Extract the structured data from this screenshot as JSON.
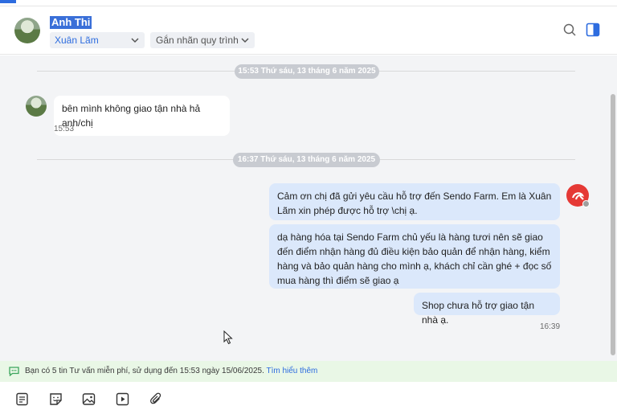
{
  "header": {
    "contact_name": "Anh Thi",
    "assignee": "Xuân Lãm",
    "tag_select": "Gắn nhãn quy trình"
  },
  "conversation": {
    "date_separators": [
      "15:53 Thứ sáu, 13 tháng 6 năm 2025",
      "16:37 Thứ sáu, 13 tháng 6 năm 2025"
    ],
    "incoming": {
      "text": "bên mình không giao tận nhà hả anh/chị",
      "time": "15:53"
    },
    "outgoing": [
      {
        "text": "Cảm ơn chị đã gửi yêu cầu hỗ trợ đến Sendo Farm. Em là Xuân Lãm xin phép được hỗ trợ \\chị ạ."
      },
      {
        "text": "dạ hàng hóa tại Sendo Farm chủ yếu là hàng tươi nên sẽ giao đến điểm nhận hàng đủ điều kiện bảo quản để nhận hàng, kiểm hàng và bảo quản hàng cho mình ạ, khách chỉ cần ghé + đọc số mua hàng thì điểm sẽ giao ạ"
      },
      {
        "text": "Shop chưa hỗ trợ giao tận nhà ạ."
      }
    ],
    "outgoing_time": "16:39"
  },
  "notice": {
    "text": "Bạn có 5 tin Tư vấn miễn phí, sử dụng đến 15:53 ngày 15/06/2025.",
    "link": "Tìm hiểu thêm"
  },
  "toolbar": {
    "icons": [
      "message-template-icon",
      "sticker-icon",
      "image-icon",
      "video-icon",
      "attachment-icon"
    ]
  },
  "colors": {
    "accent": "#2d6cdf",
    "outgoing_bubble": "#dbe8fb",
    "chat_background": "#f3f4f6",
    "notice_background": "#e9f7e6",
    "shop_avatar": "#e53935"
  }
}
